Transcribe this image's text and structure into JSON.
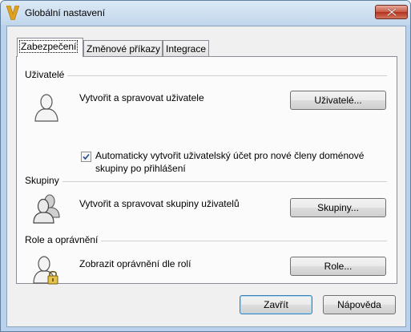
{
  "window": {
    "title": "Globální nastavení"
  },
  "tabs": [
    {
      "label": "Zabezpečení",
      "active": true
    },
    {
      "label": "Změnové příkazy",
      "active": false
    },
    {
      "label": "Integrace",
      "active": false
    }
  ],
  "sections": {
    "users": {
      "title": "Uživatelé",
      "description": "Vytvořit a spravovat uživatele",
      "button": "Uživatelé...",
      "icon": "user-icon"
    },
    "groups": {
      "title": "Skupiny",
      "description": "Vytvořit a spravovat skupiny uživatelů",
      "button": "Skupiny...",
      "icon": "group-icon"
    },
    "roles": {
      "title": "Role a oprávnění",
      "description": "Zobrazit oprávnění dle rolí",
      "button": "Role...",
      "icon": "user-lock-icon"
    }
  },
  "auto_create": {
    "label": "Automaticky vytvořit uživatelský účet pro nové členy doménové skupiny po přihlášení",
    "checked": true
  },
  "footer": {
    "close": "Zavřít",
    "help": "Nápověda"
  },
  "colors": {
    "title_bar": "#c2d7ec",
    "close_button": "#c75a45",
    "panel": "#fbfbfb",
    "default_button_border": "#3c7fb1"
  }
}
